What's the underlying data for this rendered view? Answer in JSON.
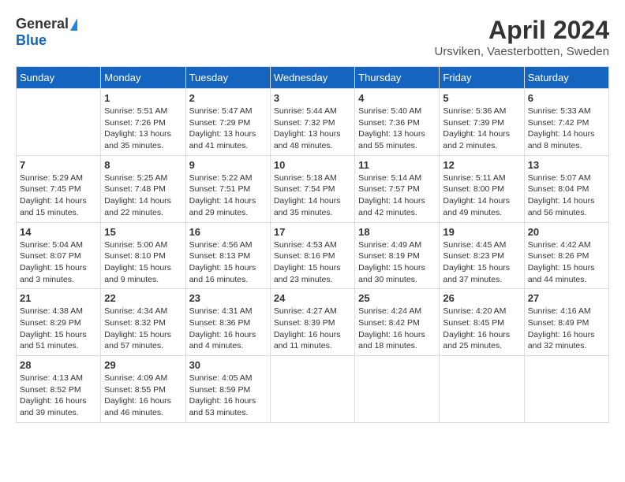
{
  "header": {
    "logo_general": "General",
    "logo_blue": "Blue",
    "month_title": "April 2024",
    "location": "Ursviken, Vaesterbotten, Sweden"
  },
  "days_of_week": [
    "Sunday",
    "Monday",
    "Tuesday",
    "Wednesday",
    "Thursday",
    "Friday",
    "Saturday"
  ],
  "weeks": [
    [
      {
        "day": "",
        "info": ""
      },
      {
        "day": "1",
        "info": "Sunrise: 5:51 AM\nSunset: 7:26 PM\nDaylight: 13 hours\nand 35 minutes."
      },
      {
        "day": "2",
        "info": "Sunrise: 5:47 AM\nSunset: 7:29 PM\nDaylight: 13 hours\nand 41 minutes."
      },
      {
        "day": "3",
        "info": "Sunrise: 5:44 AM\nSunset: 7:32 PM\nDaylight: 13 hours\nand 48 minutes."
      },
      {
        "day": "4",
        "info": "Sunrise: 5:40 AM\nSunset: 7:36 PM\nDaylight: 13 hours\nand 55 minutes."
      },
      {
        "day": "5",
        "info": "Sunrise: 5:36 AM\nSunset: 7:39 PM\nDaylight: 14 hours\nand 2 minutes."
      },
      {
        "day": "6",
        "info": "Sunrise: 5:33 AM\nSunset: 7:42 PM\nDaylight: 14 hours\nand 8 minutes."
      }
    ],
    [
      {
        "day": "7",
        "info": "Sunrise: 5:29 AM\nSunset: 7:45 PM\nDaylight: 14 hours\nand 15 minutes."
      },
      {
        "day": "8",
        "info": "Sunrise: 5:25 AM\nSunset: 7:48 PM\nDaylight: 14 hours\nand 22 minutes."
      },
      {
        "day": "9",
        "info": "Sunrise: 5:22 AM\nSunset: 7:51 PM\nDaylight: 14 hours\nand 29 minutes."
      },
      {
        "day": "10",
        "info": "Sunrise: 5:18 AM\nSunset: 7:54 PM\nDaylight: 14 hours\nand 35 minutes."
      },
      {
        "day": "11",
        "info": "Sunrise: 5:14 AM\nSunset: 7:57 PM\nDaylight: 14 hours\nand 42 minutes."
      },
      {
        "day": "12",
        "info": "Sunrise: 5:11 AM\nSunset: 8:00 PM\nDaylight: 14 hours\nand 49 minutes."
      },
      {
        "day": "13",
        "info": "Sunrise: 5:07 AM\nSunset: 8:04 PM\nDaylight: 14 hours\nand 56 minutes."
      }
    ],
    [
      {
        "day": "14",
        "info": "Sunrise: 5:04 AM\nSunset: 8:07 PM\nDaylight: 15 hours\nand 3 minutes."
      },
      {
        "day": "15",
        "info": "Sunrise: 5:00 AM\nSunset: 8:10 PM\nDaylight: 15 hours\nand 9 minutes."
      },
      {
        "day": "16",
        "info": "Sunrise: 4:56 AM\nSunset: 8:13 PM\nDaylight: 15 hours\nand 16 minutes."
      },
      {
        "day": "17",
        "info": "Sunrise: 4:53 AM\nSunset: 8:16 PM\nDaylight: 15 hours\nand 23 minutes."
      },
      {
        "day": "18",
        "info": "Sunrise: 4:49 AM\nSunset: 8:19 PM\nDaylight: 15 hours\nand 30 minutes."
      },
      {
        "day": "19",
        "info": "Sunrise: 4:45 AM\nSunset: 8:23 PM\nDaylight: 15 hours\nand 37 minutes."
      },
      {
        "day": "20",
        "info": "Sunrise: 4:42 AM\nSunset: 8:26 PM\nDaylight: 15 hours\nand 44 minutes."
      }
    ],
    [
      {
        "day": "21",
        "info": "Sunrise: 4:38 AM\nSunset: 8:29 PM\nDaylight: 15 hours\nand 51 minutes."
      },
      {
        "day": "22",
        "info": "Sunrise: 4:34 AM\nSunset: 8:32 PM\nDaylight: 15 hours\nand 57 minutes."
      },
      {
        "day": "23",
        "info": "Sunrise: 4:31 AM\nSunset: 8:36 PM\nDaylight: 16 hours\nand 4 minutes."
      },
      {
        "day": "24",
        "info": "Sunrise: 4:27 AM\nSunset: 8:39 PM\nDaylight: 16 hours\nand 11 minutes."
      },
      {
        "day": "25",
        "info": "Sunrise: 4:24 AM\nSunset: 8:42 PM\nDaylight: 16 hours\nand 18 minutes."
      },
      {
        "day": "26",
        "info": "Sunrise: 4:20 AM\nSunset: 8:45 PM\nDaylight: 16 hours\nand 25 minutes."
      },
      {
        "day": "27",
        "info": "Sunrise: 4:16 AM\nSunset: 8:49 PM\nDaylight: 16 hours\nand 32 minutes."
      }
    ],
    [
      {
        "day": "28",
        "info": "Sunrise: 4:13 AM\nSunset: 8:52 PM\nDaylight: 16 hours\nand 39 minutes."
      },
      {
        "day": "29",
        "info": "Sunrise: 4:09 AM\nSunset: 8:55 PM\nDaylight: 16 hours\nand 46 minutes."
      },
      {
        "day": "30",
        "info": "Sunrise: 4:05 AM\nSunset: 8:59 PM\nDaylight: 16 hours\nand 53 minutes."
      },
      {
        "day": "",
        "info": ""
      },
      {
        "day": "",
        "info": ""
      },
      {
        "day": "",
        "info": ""
      },
      {
        "day": "",
        "info": ""
      }
    ]
  ]
}
